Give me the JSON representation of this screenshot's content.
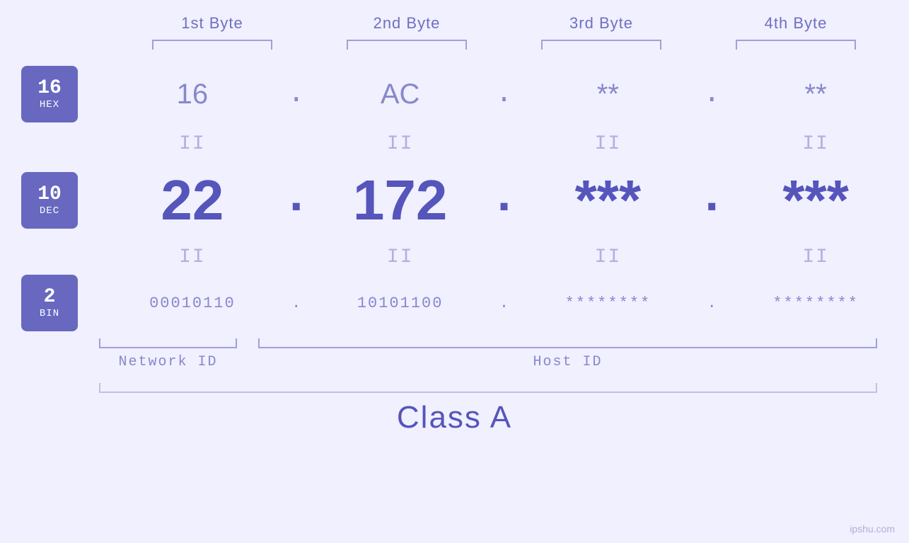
{
  "headers": {
    "byte1": "1st Byte",
    "byte2": "2nd Byte",
    "byte3": "3rd Byte",
    "byte4": "4th Byte"
  },
  "badges": {
    "hex": {
      "num": "16",
      "base": "HEX"
    },
    "dec": {
      "num": "10",
      "base": "DEC"
    },
    "bin": {
      "num": "2",
      "base": "BIN"
    }
  },
  "hex_row": {
    "b1": "16",
    "b2": "AC",
    "b3": "**",
    "b4": "**",
    "dot": "."
  },
  "dec_row": {
    "b1": "22",
    "b2": "172",
    "b3": "***",
    "b4": "***",
    "dot": "."
  },
  "bin_row": {
    "b1": "00010110",
    "b2": "10101100",
    "b3": "********",
    "b4": "********",
    "dot": "."
  },
  "labels": {
    "network_id": "Network ID",
    "host_id": "Host ID",
    "class": "Class A"
  },
  "equals": "II",
  "watermark": "ipshu.com"
}
